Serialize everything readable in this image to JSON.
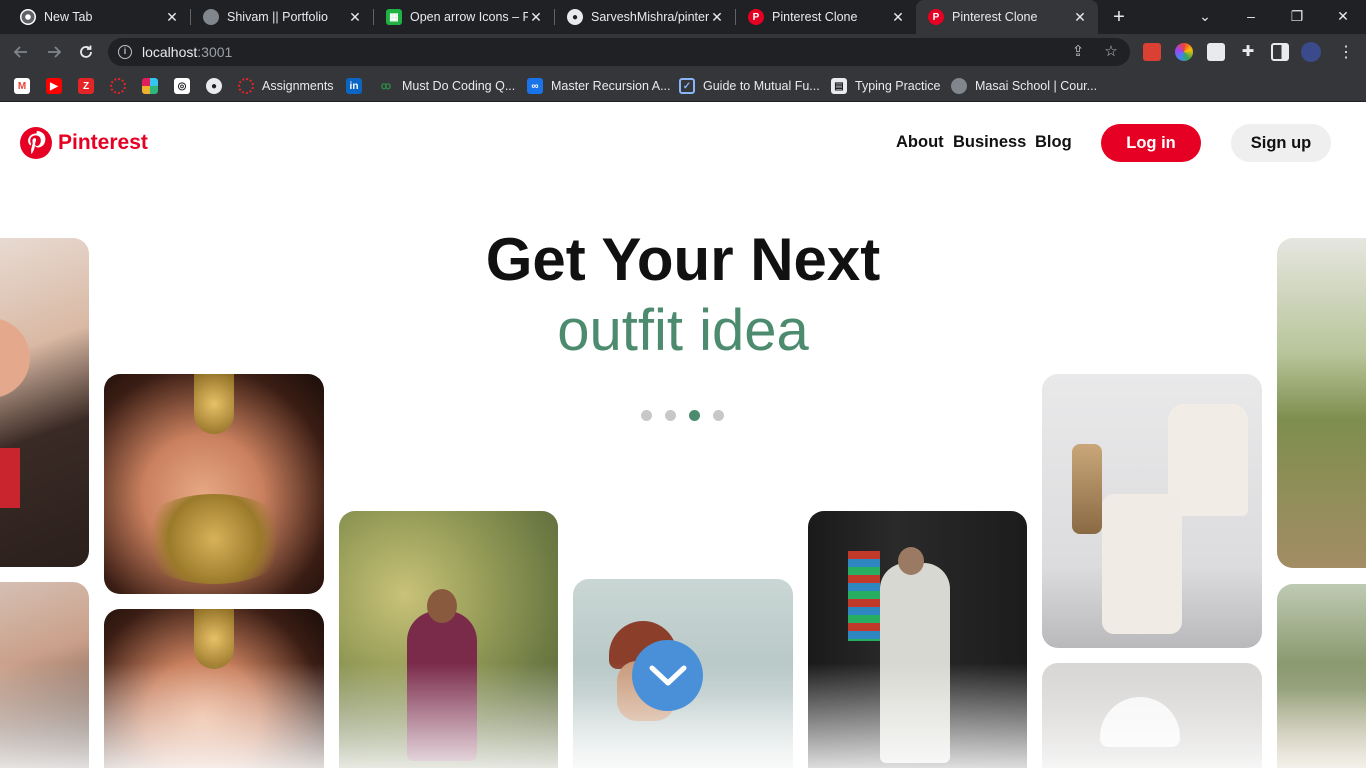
{
  "browser": {
    "tabs": [
      {
        "title": "New Tab",
        "icon": "chrome-icon"
      },
      {
        "title": "Shivam || Portfolio",
        "icon": "globe-icon"
      },
      {
        "title": "Open arrow Icons – Fr",
        "icon": "iconpark-icon"
      },
      {
        "title": "SarveshMishra/pinter",
        "icon": "github-icon"
      },
      {
        "title": "Pinterest Clone",
        "icon": "pinterest-icon"
      },
      {
        "title": "Pinterest Clone",
        "icon": "pinterest-icon",
        "active": true
      }
    ],
    "url_host": "localhost",
    "url_port": ":3001",
    "bookmarks": [
      {
        "label": "",
        "icon": "gmail-icon"
      },
      {
        "label": "",
        "icon": "youtube-icon"
      },
      {
        "label": "",
        "icon": "zoho-icon"
      },
      {
        "label": "",
        "icon": "ring-icon"
      },
      {
        "label": "",
        "icon": "slack-icon"
      },
      {
        "label": "",
        "icon": "chatgpt-icon"
      },
      {
        "label": "",
        "icon": "github-icon"
      },
      {
        "label": "Assignments",
        "icon": "masai-icon"
      },
      {
        "label": "",
        "icon": "linkedin-icon"
      },
      {
        "label": "Must Do Coding Q...",
        "icon": "gfg-icon"
      },
      {
        "label": "Master Recursion A...",
        "icon": "infinity-icon"
      },
      {
        "label": "Guide to Mutual Fu...",
        "icon": "checkbox-icon"
      },
      {
        "label": "Typing Practice",
        "icon": "document-icon"
      },
      {
        "label": "Masai School | Cour...",
        "icon": "globe-icon"
      }
    ]
  },
  "site": {
    "brand": "Pinterest",
    "nav": [
      "About",
      "Business",
      "Blog"
    ],
    "login_label": "Log in",
    "signup_label": "Sign up",
    "hero_title": "Get Your Next",
    "hero_subtitle": "outfit idea",
    "carousel": {
      "count": 4,
      "active_index": 2
    },
    "colors": {
      "brand": "#e60023",
      "accent": "#4d8b6f",
      "scroll_button": "#4a90d9"
    }
  }
}
